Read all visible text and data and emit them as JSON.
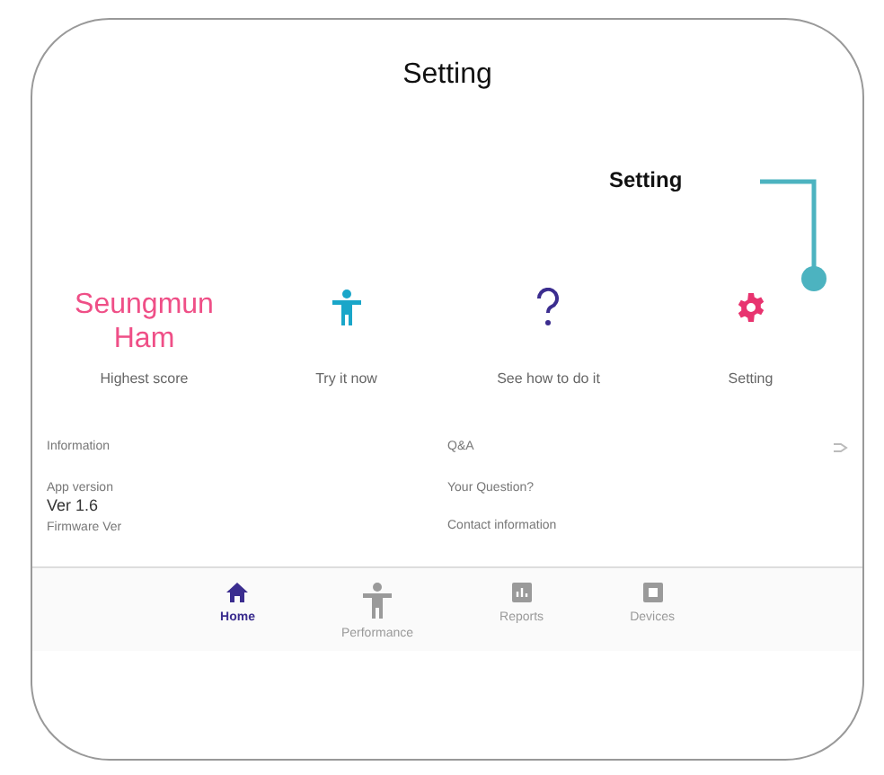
{
  "window": {
    "title": "Setting"
  },
  "callout": {
    "label": "Setting"
  },
  "user": {
    "name": "Seungmun Ham",
    "caption": "Highest score"
  },
  "tiles": [
    {
      "kind": "person",
      "label": "Try it now"
    },
    {
      "kind": "question",
      "label": "See how to do it"
    },
    {
      "kind": "gear",
      "label": "Setting"
    }
  ],
  "information": {
    "title": "Information",
    "items": [
      {
        "label": "App version",
        "value": "Ver 1.6"
      },
      {
        "label": "Firmware Ver"
      }
    ]
  },
  "qna": {
    "title": "Q&A",
    "items": [
      "Your Question?",
      "Contact information"
    ]
  },
  "nav": [
    {
      "kind": "home",
      "label": "Home",
      "selected": true
    },
    {
      "kind": "person",
      "label": "Performance",
      "selected": false
    },
    {
      "kind": "reports",
      "label": "Reports",
      "selected": false
    },
    {
      "kind": "device",
      "label": "Devices",
      "selected": false
    }
  ]
}
